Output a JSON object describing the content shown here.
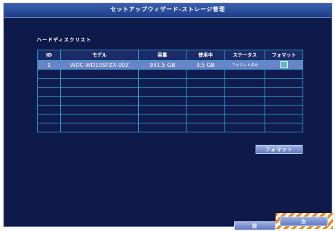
{
  "window": {
    "title": "セットアップウィザード-ストレージ管理"
  },
  "section": {
    "label": "ハードディスクリスト"
  },
  "table": {
    "headers": [
      "ID",
      "モデル",
      "容量",
      "使用中",
      "ステータス",
      "フォマット"
    ],
    "rows": [
      {
        "id": "1",
        "model": "WDC WD10SPZX-00Z",
        "capacity": "931.5 GB",
        "used": "3.5 GB",
        "status": "フォマット済み",
        "selected": true
      }
    ],
    "empty_rows": 7
  },
  "buttons": {
    "format": "フォマット",
    "prev": "前",
    "next": "次"
  },
  "colors": {
    "window_bg": "#0e1a4a",
    "grid_line": "#2e9cc7",
    "selected_row": "#6c83c8",
    "highlight_frame": "#f28a16"
  }
}
